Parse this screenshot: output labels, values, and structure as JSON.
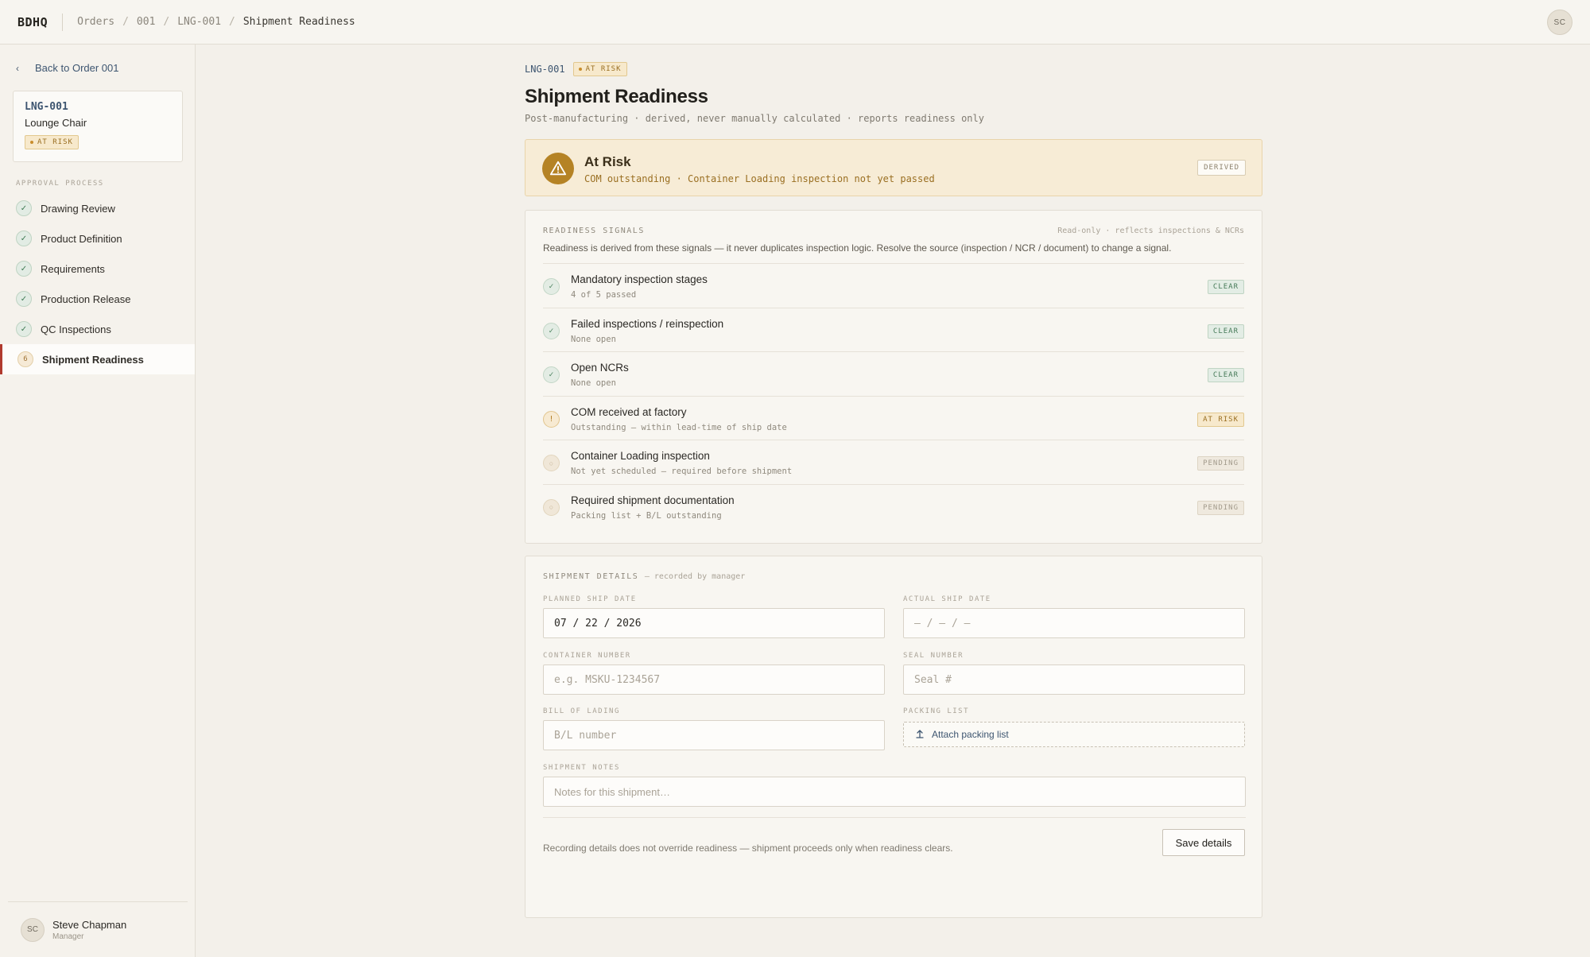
{
  "app": {
    "brand": "BDHQ",
    "user_initials": "SC"
  },
  "breadcrumb": [
    "Orders",
    "001",
    "LNG-001",
    "Shipment Readiness"
  ],
  "sidebar": {
    "back_label": "Back to Order 001",
    "item": {
      "code": "LNG-001",
      "name": "Lounge Chair",
      "status": "AT RISK"
    },
    "section_label": "APPROVAL PROCESS",
    "steps": [
      {
        "label": "Drawing Review",
        "state": "done",
        "marker": "✓"
      },
      {
        "label": "Product Definition",
        "state": "done",
        "marker": "✓"
      },
      {
        "label": "Requirements",
        "state": "done",
        "marker": "✓"
      },
      {
        "label": "Production Release",
        "state": "done",
        "marker": "✓"
      },
      {
        "label": "QC Inspections",
        "state": "done",
        "marker": "✓"
      },
      {
        "label": "Shipment Readiness",
        "state": "active",
        "marker": "6"
      }
    ],
    "user": {
      "initials": "SC",
      "name": "Steve Chapman",
      "role": "Manager"
    }
  },
  "header": {
    "code": "LNG-001",
    "status_badge": "AT RISK",
    "title": "Shipment Readiness",
    "subtitle": "Post-manufacturing · derived, never manually calculated · reports readiness only"
  },
  "status": {
    "title": "At Risk",
    "description": "COM outstanding · Container Loading inspection not yet passed",
    "tag": "DERIVED"
  },
  "signals": {
    "label": "READINESS SIGNALS",
    "note": "Read-only · reflects inspections & NCRs",
    "intro": "Readiness is derived from these signals — it never duplicates inspection logic. Resolve the source (inspection / NCR / document) to change a signal.",
    "items": [
      {
        "title": "Mandatory inspection stages",
        "sub": "4 of 5 passed",
        "status": "CLEAR",
        "icon": "✓"
      },
      {
        "title": "Failed inspections / reinspection",
        "sub": "None open",
        "status": "CLEAR",
        "icon": "✓"
      },
      {
        "title": "Open NCRs",
        "sub": "None open",
        "status": "CLEAR",
        "icon": "✓"
      },
      {
        "title": "COM received at factory",
        "sub": "Outstanding — within lead-time of ship date",
        "status": "AT RISK",
        "icon": "!"
      },
      {
        "title": "Container Loading inspection",
        "sub": "Not yet scheduled — required before shipment",
        "status": "PENDING",
        "icon": "○"
      },
      {
        "title": "Required shipment documentation",
        "sub": "Packing list + B/L outstanding",
        "status": "PENDING",
        "icon": "○"
      }
    ]
  },
  "details": {
    "label": "SHIPMENT DETAILS",
    "recorded_note": "— recorded by manager",
    "planned_ship_date": {
      "label": "PLANNED SHIP DATE",
      "value": "07 / 22 / 2026"
    },
    "actual_ship_date": {
      "label": "ACTUAL SHIP DATE",
      "value": "– / – / –"
    },
    "container_number": {
      "label": "CONTAINER NUMBER",
      "placeholder": "e.g. MSKU-1234567"
    },
    "seal_number": {
      "label": "SEAL NUMBER",
      "placeholder": "Seal #"
    },
    "bill_of_lading": {
      "label": "BILL OF LADING",
      "placeholder": "B/L number"
    },
    "packing_list": {
      "label": "PACKING LIST",
      "action": "Attach packing list"
    },
    "notes": {
      "label": "SHIPMENT NOTES",
      "placeholder": "Notes for this shipment…"
    },
    "footer_note": "Recording details does not override readiness — shipment proceeds only when readiness clears.",
    "save_label": "Save details"
  },
  "colors": {
    "accent_active": "#b03a2e",
    "risk": "#b58325",
    "clear": "#467a58",
    "link": "#3d5570"
  }
}
